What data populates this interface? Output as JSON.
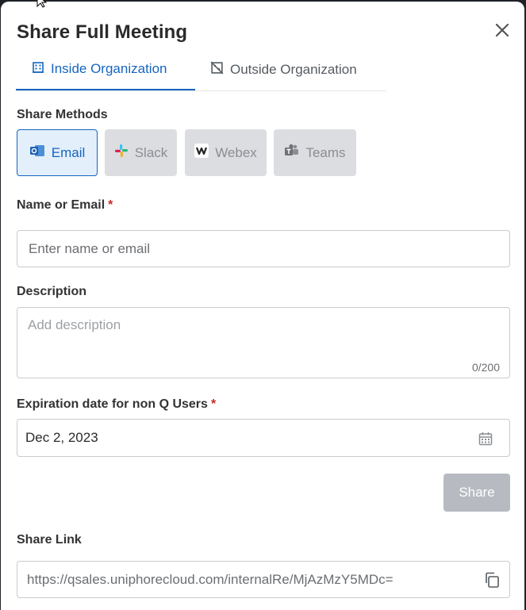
{
  "modal": {
    "title": "Share Full Meeting"
  },
  "tabs": [
    {
      "label": "Inside Organization",
      "active": true,
      "icon": "building-icon"
    },
    {
      "label": "Outside Organization",
      "active": false,
      "icon": "building-off-icon"
    }
  ],
  "share_methods": {
    "label": "Share Methods",
    "items": [
      {
        "label": "Email",
        "icon": "outlook-icon",
        "active": true
      },
      {
        "label": "Slack",
        "icon": "slack-icon",
        "active": false
      },
      {
        "label": "Webex",
        "icon": "webex-icon",
        "active": false
      },
      {
        "label": "Teams",
        "icon": "teams-icon",
        "active": false
      }
    ]
  },
  "name_field": {
    "label": "Name or Email",
    "required_mark": "*",
    "placeholder": "Enter name or email"
  },
  "description_field": {
    "label": "Description",
    "placeholder": "Add description",
    "counter": "0/200"
  },
  "expiration_field": {
    "label": "Expiration date for non Q Users",
    "required_mark": "*",
    "value": "Dec 2, 2023",
    "icon": "calendar-icon"
  },
  "share_button": {
    "label": "Share"
  },
  "share_link": {
    "label": "Share Link",
    "value": "https://qsales.uniphorecloud.com/internalRe/MjAzMzY5MDc=",
    "icon": "copy-icon"
  },
  "colors": {
    "accent": "#1565c0",
    "required": "#c62828",
    "disabled_button": "#b7bbc1"
  }
}
